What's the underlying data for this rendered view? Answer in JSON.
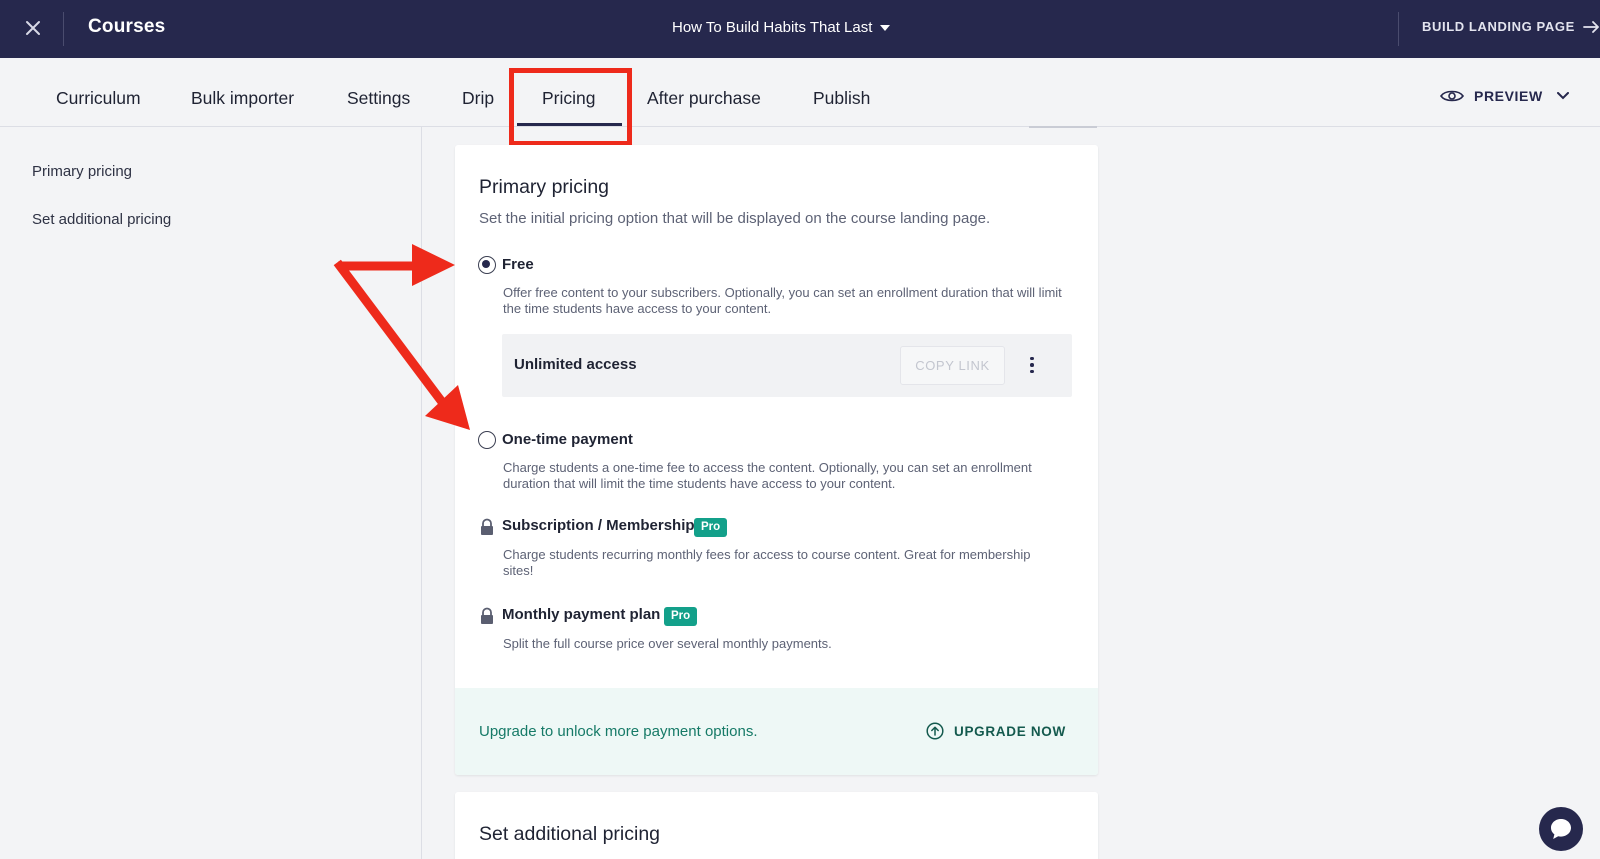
{
  "topbar": {
    "app_title": "Courses",
    "course_name": "How To Build Habits That Last",
    "build_landing_label": "BUILD LANDING PAGE"
  },
  "tabs": [
    {
      "label": "Curriculum"
    },
    {
      "label": "Bulk importer"
    },
    {
      "label": "Settings"
    },
    {
      "label": "Drip"
    },
    {
      "label": "Pricing",
      "active": true
    },
    {
      "label": "After purchase"
    },
    {
      "label": "Publish"
    }
  ],
  "preview_label": "PREVIEW",
  "sidebar": {
    "items": [
      {
        "label": "Primary pricing"
      },
      {
        "label": "Set additional pricing"
      }
    ]
  },
  "primary_pricing": {
    "title": "Primary pricing",
    "subtitle": "Set the initial pricing option that will be displayed on the course landing page.",
    "options": [
      {
        "label": "Free",
        "selected": true,
        "locked": false,
        "description": "Offer free content to your subscribers. Optionally, you can set an enrollment duration that will limit the time students have access to your content."
      },
      {
        "label": "One-time payment",
        "selected": false,
        "locked": false,
        "description": "Charge students a one-time fee to access the content. Optionally, you can set an enrollment duration that will limit the time students have access to your content."
      },
      {
        "label": "Subscription / Membership",
        "selected": false,
        "locked": true,
        "badge": "Pro",
        "description": "Charge students recurring monthly fees for access to course content. Great for membership sites!"
      },
      {
        "label": "Monthly payment plan",
        "selected": false,
        "locked": true,
        "badge": "Pro",
        "description": "Split the full course price over several monthly payments."
      }
    ],
    "access": {
      "label": "Unlimited access",
      "copy_link_label": "COPY LINK"
    },
    "upgrade": {
      "text": "Upgrade to unlock more payment options.",
      "button_label": "UPGRADE NOW"
    }
  },
  "additional_pricing": {
    "title": "Set additional pricing"
  },
  "colors": {
    "topbar_bg": "#26284d",
    "accent_teal": "#13a08a",
    "annotation_red": "#ee2a1b",
    "upgrade_bg": "#eef8f6"
  },
  "icons": {
    "close": "close-icon",
    "course_dropdown": "caret-down-icon",
    "build_landing": "arrow-right-icon",
    "preview": "eye-icon",
    "preview_dropdown": "chevron-down-icon",
    "locked_option": "lock-icon",
    "upgrade": "arrow-up-circle-icon",
    "chat": "chat-bubble-icon"
  }
}
